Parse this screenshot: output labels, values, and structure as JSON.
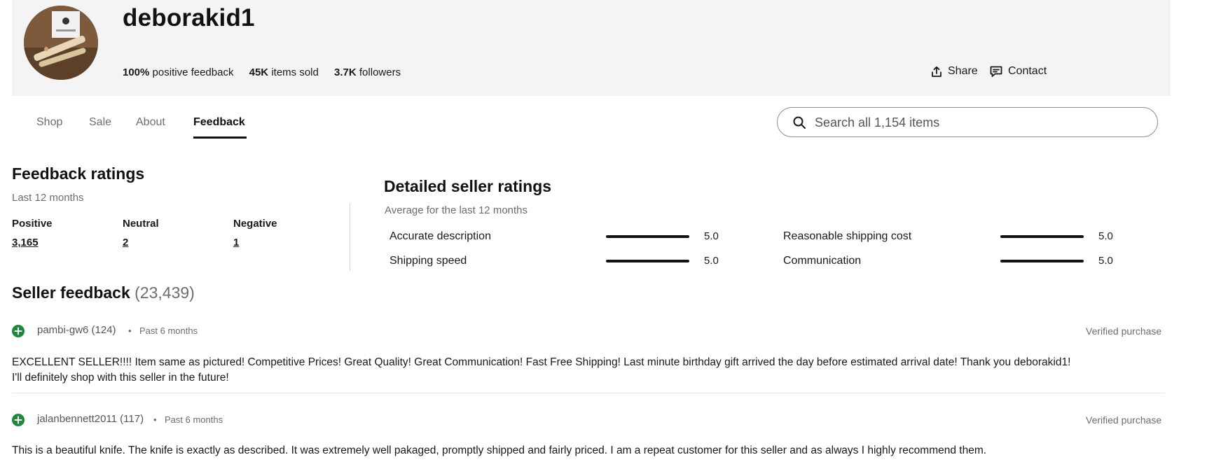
{
  "seller": {
    "name": "deborakid1",
    "stats": [
      {
        "value": "100%",
        "label": "positive feedback"
      },
      {
        "value": "45K",
        "label": "items sold"
      },
      {
        "value": "3.7K",
        "label": "followers"
      }
    ],
    "actions": {
      "share": "Share",
      "contact": "Contact"
    },
    "share_icon": "share-icon",
    "contact_icon": "message-icon"
  },
  "tabs": [
    {
      "label": "Shop",
      "active": false
    },
    {
      "label": "Sale",
      "active": false
    },
    {
      "label": "About",
      "active": false
    },
    {
      "label": "Feedback",
      "active": true
    }
  ],
  "search": {
    "placeholder": "Search all 1,154 items",
    "icon": "search-icon"
  },
  "feedback_ratings": {
    "title": "Feedback ratings",
    "subtitle": "Last 12 months",
    "columns": [
      {
        "label": "Positive",
        "count": "3,165"
      },
      {
        "label": "Neutral",
        "count": "2"
      },
      {
        "label": "Negative",
        "count": "1"
      }
    ]
  },
  "detailed_ratings": {
    "title": "Detailed seller ratings",
    "subtitle": "Average for the last 12 months",
    "items": [
      {
        "label": "Accurate description",
        "score": "5.0",
        "fill": 1.0
      },
      {
        "label": "Reasonable shipping cost",
        "score": "5.0",
        "fill": 1.0
      },
      {
        "label": "Shipping speed",
        "score": "5.0",
        "fill": 1.0
      },
      {
        "label": "Communication",
        "score": "5.0",
        "fill": 1.0
      }
    ]
  },
  "seller_feedback": {
    "title": "Seller feedback",
    "count": "(23,439)",
    "entries": [
      {
        "user": "pambi-gw6 (124)",
        "separator": "•",
        "time": "Past 6 months",
        "verified": "Verified purchase",
        "text_lines": [
          "EXCELLENT SELLER!!!! Item same as pictured! Competitive Prices! Great Quality! Great Communication! Fast Free Shipping! Last minute birthday gift arrived the day before estimated arrival date! Thank you deborakid1!",
          "I'll definitely shop with this seller in the future!"
        ]
      },
      {
        "user": "jalanbennett2011 (117)",
        "separator": "•",
        "time": "Past 6 months",
        "verified": "Verified purchase",
        "text_lines": [
          "This is a beautiful knife. The knife is exactly as described. It was extremely well pakaged, promptly shipped and fairly priced. I am a repeat customer for this seller and as always I highly recommend them."
        ]
      }
    ]
  },
  "colors": {
    "positive": "#1b8a3a",
    "header_bg": "#f4f4f4"
  }
}
